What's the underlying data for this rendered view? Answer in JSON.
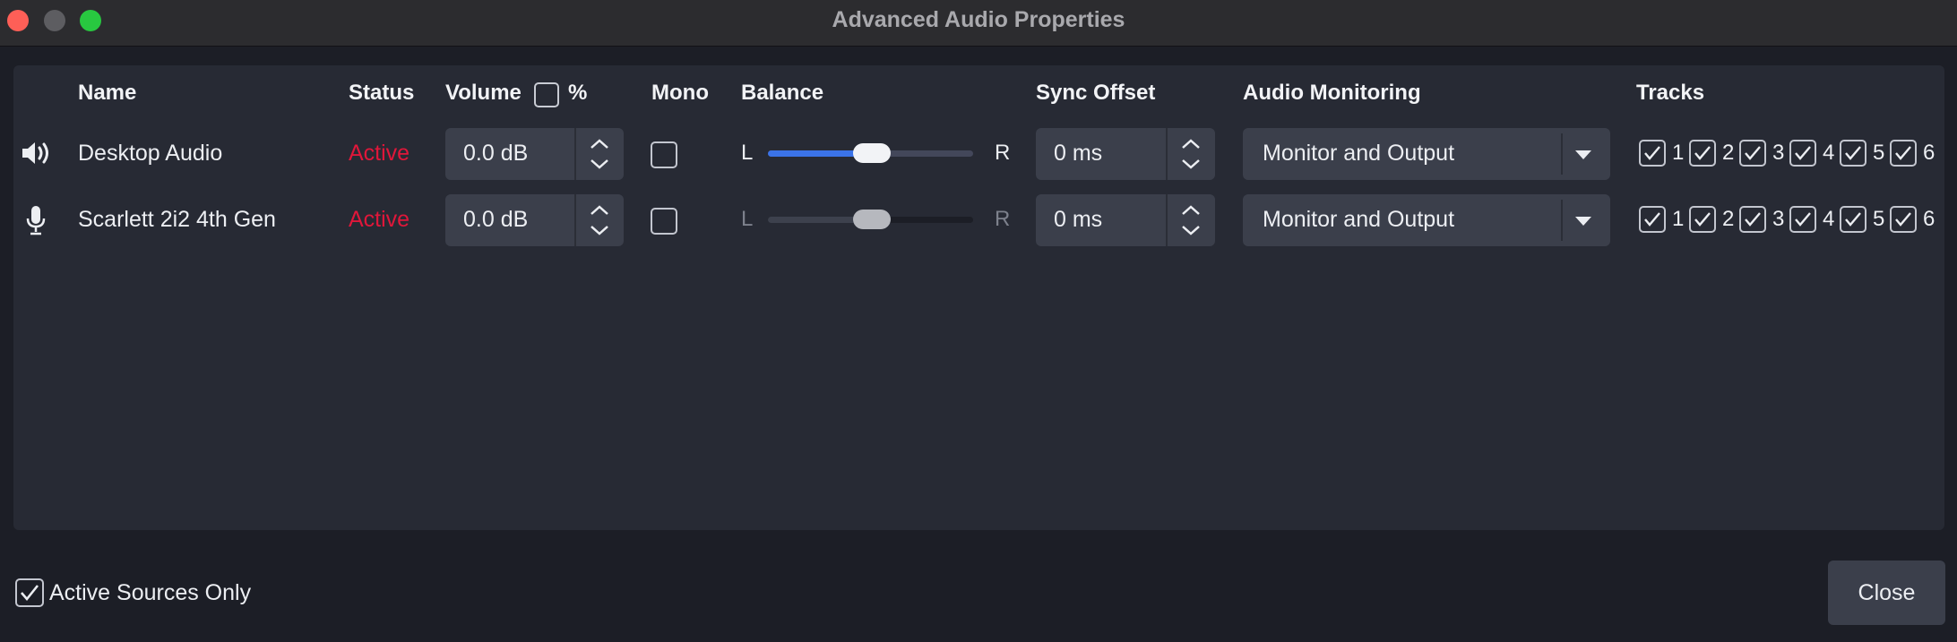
{
  "window": {
    "title": "Advanced Audio Properties"
  },
  "headers": {
    "name": "Name",
    "status": "Status",
    "volume": "Volume",
    "volume_unit": "%",
    "mono": "Mono",
    "balance": "Balance",
    "sync_offset": "Sync Offset",
    "audio_monitoring": "Audio Monitoring",
    "tracks": "Tracks"
  },
  "rows": [
    {
      "icon": "speaker-icon",
      "name": "Desktop Audio",
      "status": "Active",
      "volume": "0.0 dB",
      "mono": false,
      "balance_left": "L",
      "balance_right": "R",
      "balance": 0.5,
      "balance_enabled": true,
      "sync_offset": "0 ms",
      "monitoring": "Monitor and Output",
      "tracks": [
        {
          "label": "1",
          "checked": true
        },
        {
          "label": "2",
          "checked": true
        },
        {
          "label": "3",
          "checked": true
        },
        {
          "label": "4",
          "checked": true
        },
        {
          "label": "5",
          "checked": true
        },
        {
          "label": "6",
          "checked": true
        }
      ]
    },
    {
      "icon": "microphone-icon",
      "name": "Scarlett 2i2 4th Gen",
      "status": "Active",
      "volume": "0.0 dB",
      "mono": false,
      "balance_left": "L",
      "balance_right": "R",
      "balance": 0.5,
      "balance_enabled": false,
      "sync_offset": "0 ms",
      "monitoring": "Monitor and Output",
      "tracks": [
        {
          "label": "1",
          "checked": true
        },
        {
          "label": "2",
          "checked": true
        },
        {
          "label": "3",
          "checked": true
        },
        {
          "label": "4",
          "checked": true
        },
        {
          "label": "5",
          "checked": true
        },
        {
          "label": "6",
          "checked": true
        }
      ]
    }
  ],
  "footer": {
    "active_sources_only_label": "Active Sources Only",
    "active_sources_only_checked": true,
    "close_label": "Close"
  },
  "colors": {
    "status_active": "#e0173a",
    "accent": "#3b73e8"
  }
}
